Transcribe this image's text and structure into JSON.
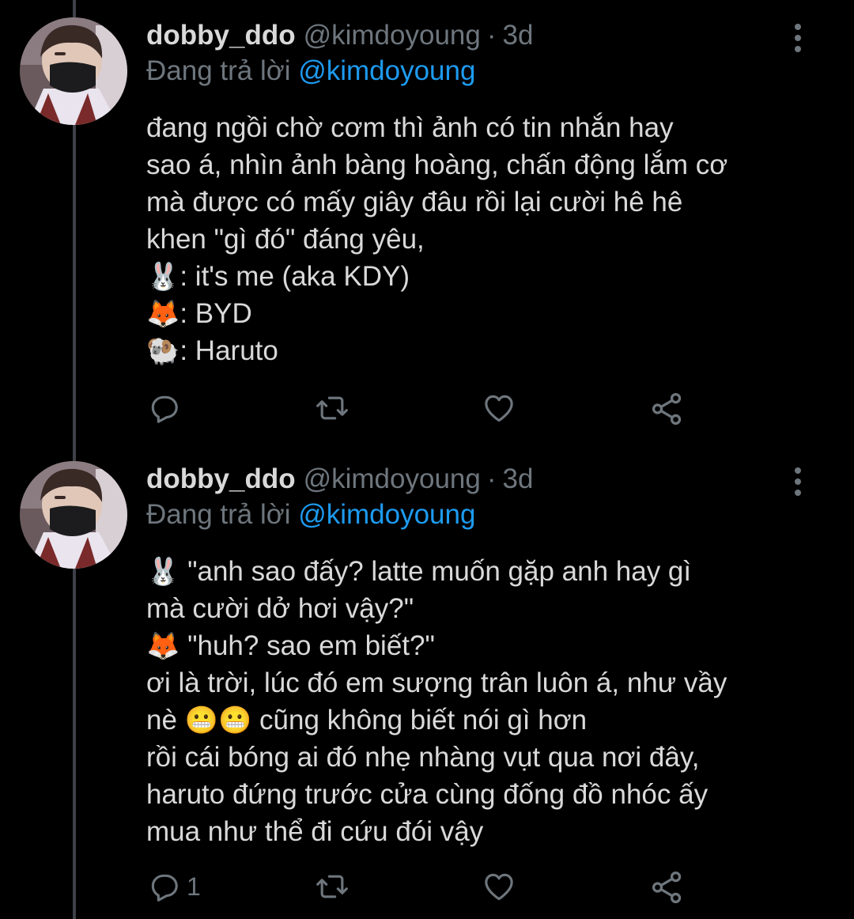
{
  "colors": {
    "background": "#000000",
    "text": "#d9d9d9",
    "muted": "#6e767d",
    "link": "#1d9bf0",
    "thread_line": "#3d4147"
  },
  "tweets": [
    {
      "author_name": "dobby_ddo",
      "author_handle": "@kimdoyoung",
      "separator": "·",
      "time": "3d",
      "replying_prefix": "Đang trả lời",
      "replying_to": "@kimdoyoung",
      "lines": [
        "đang ngồi chờ cơm thì ảnh có tin nhắn hay",
        "sao á, nhìn ảnh bàng hoàng, chấn động lắm cơ",
        "mà được có mấy giây đâu rồi lại cười hê hê",
        "khen \"gì đó\" đáng yêu,"
      ],
      "emoji_lines": [
        {
          "emoji": "🐰",
          "text": ": it's me (aka KDY)"
        },
        {
          "emoji": "🦊",
          "text": ": BYD"
        },
        {
          "emoji": "🐏",
          "text": ": Haruto"
        }
      ],
      "actions": {
        "reply_count": "",
        "retweet_count": "",
        "like_count": ""
      }
    },
    {
      "author_name": "dobby_ddo",
      "author_handle": "@kimdoyoung",
      "separator": "·",
      "time": "3d",
      "replying_prefix": "Đang trả lời",
      "replying_to": "@kimdoyoung",
      "lines": [
        {
          "emoji": "🐰",
          "text": " \"anh sao đấy? latte muốn gặp anh hay gì"
        },
        {
          "emoji": "",
          "text": "mà cười dở hơi vậy?\""
        },
        {
          "emoji": "🦊",
          "text": " \"huh? sao em biết?\""
        },
        {
          "emoji": "",
          "text": "ơi là trời, lúc đó em sượng trân luôn á, như vầy"
        },
        {
          "prefix": "nè ",
          "emoji": "😬😬",
          "text": " cũng không biết nói gì hơn"
        },
        {
          "emoji": "",
          "text": "rồi cái bóng ai đó nhẹ nhàng vụt qua nơi đây,"
        },
        {
          "emoji": "",
          "text": "haruto đứng trước cửa cùng đống đồ nhóc ấy"
        },
        {
          "emoji": "",
          "text": "mua như thể đi cứu đói vậy"
        }
      ],
      "actions": {
        "reply_count": "1",
        "retweet_count": "",
        "like_count": ""
      }
    }
  ]
}
